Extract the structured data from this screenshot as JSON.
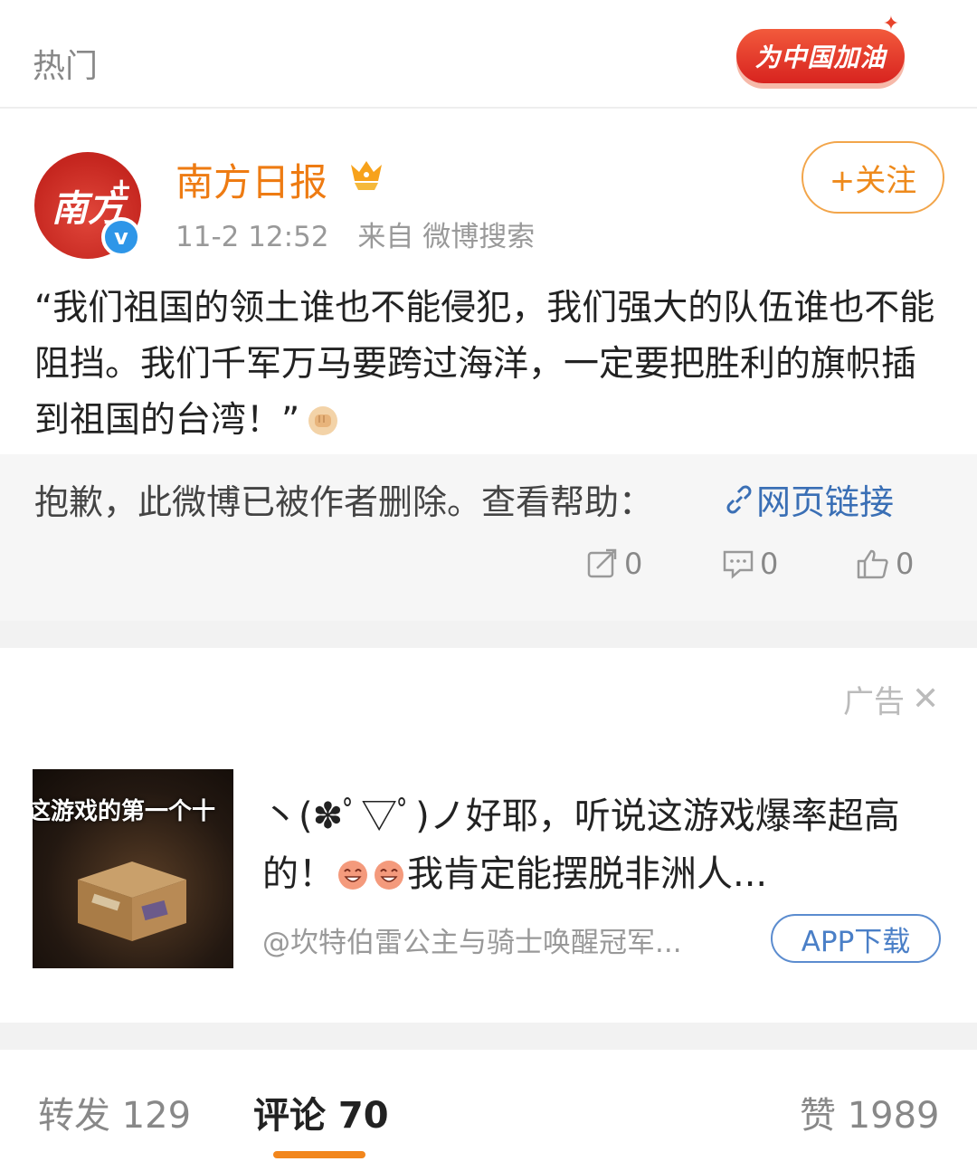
{
  "header": {
    "title": "热门",
    "badge_label": "为中国加油"
  },
  "post": {
    "author": "南方日报",
    "avatar_text": "南方",
    "verified_mark": "v",
    "time": "11-2 12:52",
    "source": "来自 微博搜索",
    "follow_label": "+关注",
    "text": "“我们祖国的领土谁也不能侵犯，我们强大的队伍谁也不能阻挡。我们千军万马要跨过海洋，一定要把胜利的旗帜插到祖国的台湾！”",
    "deleted_notice": "抱歉，此微博已被作者删除。查看帮助：",
    "link_label": "网页链接",
    "repost_count": "0",
    "comment_count": "0",
    "like_count": "0"
  },
  "ad": {
    "label": "广告",
    "close": "✕",
    "thumb_caption": "这游戏的第一个十",
    "text_part1": "丶(✽ﾟ▽ﾟ)ノ好耶，听说这游戏爆率超高的！",
    "text_part2": "我肯定能摆脱非洲人...",
    "source": "@坎特伯雷公主与骑士唤醒冠军...",
    "button": "APP下载"
  },
  "tabs": {
    "repost": "转发 129",
    "comment": "评论 70",
    "like": "赞 1989"
  },
  "colors": {
    "accent_orange": "#ee7b12",
    "link_blue": "#3a6fb5",
    "avatar_red": "#c5261f"
  }
}
